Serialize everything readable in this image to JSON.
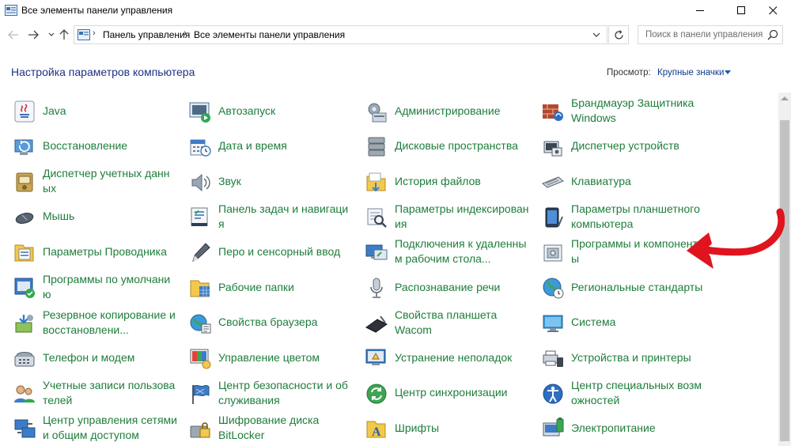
{
  "window": {
    "title": "Все элементы панели управления"
  },
  "address": {
    "crumbs": [
      "Панель управления",
      "Все элементы панели управления"
    ]
  },
  "search": {
    "placeholder": "Поиск в панели управления"
  },
  "header": {
    "title": "Настройка параметров компьютера",
    "view_label": "Просмотр:",
    "view_value": "Крупные значки"
  },
  "colors": {
    "item_text": "#1e7d3b",
    "title_text": "#1e3287",
    "annotation_arrow": "#e0141e"
  },
  "items": [
    {
      "label": "Java",
      "icon": "java-icon"
    },
    {
      "label": "Автозапуск",
      "icon": "autoplay-icon"
    },
    {
      "label": "Администрирование",
      "icon": "admin-tools-icon"
    },
    {
      "label": "Брандмауэр Защитника\nWindows",
      "icon": "firewall-icon"
    },
    {
      "label": "Восстановление",
      "icon": "recovery-icon"
    },
    {
      "label": "Дата и время",
      "icon": "date-time-icon"
    },
    {
      "label": "Дисковые пространства",
      "icon": "storage-spaces-icon"
    },
    {
      "label": "Диспетчер устройств",
      "icon": "device-manager-icon"
    },
    {
      "label": "Диспетчер учетных данн\nых",
      "icon": "credential-manager-icon"
    },
    {
      "label": "Звук",
      "icon": "sound-icon"
    },
    {
      "label": "История файлов",
      "icon": "file-history-icon"
    },
    {
      "label": "Клавиатура",
      "icon": "keyboard-icon"
    },
    {
      "label": "Мышь",
      "icon": "mouse-icon"
    },
    {
      "label": "Панель задач и навигаци\nя",
      "icon": "taskbar-icon"
    },
    {
      "label": "Параметры индексирован\nия",
      "icon": "indexing-icon"
    },
    {
      "label": "Параметры планшетного\nкомпьютера",
      "icon": "tablet-pc-icon"
    },
    {
      "label": "Параметры Проводника",
      "icon": "explorer-options-icon"
    },
    {
      "label": "Перо и сенсорный ввод",
      "icon": "pen-icon"
    },
    {
      "label": "Подключения к удаленны\nм рабочим стола...",
      "icon": "remote-desktop-icon"
    },
    {
      "label": "Программы и компонент\nы",
      "icon": "programs-features-icon"
    },
    {
      "label": "Программы по умолчани\nю",
      "icon": "default-programs-icon"
    },
    {
      "label": "Рабочие папки",
      "icon": "work-folders-icon"
    },
    {
      "label": "Распознавание речи",
      "icon": "microphone-icon"
    },
    {
      "label": "Региональные стандарты",
      "icon": "region-icon"
    },
    {
      "label": "Резервное копирование и\nвосстановлени...",
      "icon": "backup-icon"
    },
    {
      "label": "Свойства браузера",
      "icon": "internet-options-icon"
    },
    {
      "label": "Свойства планшета\nWacom",
      "icon": "wacom-tablet-icon"
    },
    {
      "label": "Система",
      "icon": "system-icon"
    },
    {
      "label": "Телефон и модем",
      "icon": "phone-modem-icon"
    },
    {
      "label": "Управление цветом",
      "icon": "color-management-icon"
    },
    {
      "label": "Устранение неполадок",
      "icon": "troubleshooting-icon"
    },
    {
      "label": "Устройства и принтеры",
      "icon": "devices-printers-icon"
    },
    {
      "label": "Учетные записи пользова\nтелей",
      "icon": "user-accounts-icon"
    },
    {
      "label": "Центр безопасности и об\nслуживания",
      "icon": "security-flag-icon"
    },
    {
      "label": "Центр синхронизации",
      "icon": "sync-center-icon"
    },
    {
      "label": "Центр специальных возм\nожностей",
      "icon": "ease-of-access-icon"
    },
    {
      "label": "Центр управления сетями\nи общим доступом",
      "icon": "network-center-icon"
    },
    {
      "label": "Шифрование диска\nBitLocker",
      "icon": "bitlocker-icon"
    },
    {
      "label": "Шрифты",
      "icon": "fonts-icon"
    },
    {
      "label": "Электропитание",
      "icon": "power-options-icon"
    }
  ]
}
